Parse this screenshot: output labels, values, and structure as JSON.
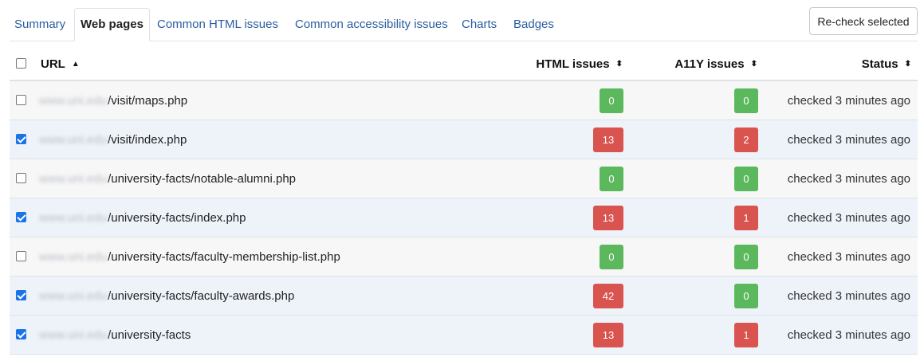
{
  "tabs": [
    {
      "label": "Summary"
    },
    {
      "label": "Web pages",
      "active": true
    },
    {
      "label": "Common HTML issues"
    },
    {
      "label": "Common accessibility issues"
    },
    {
      "label": "Charts"
    },
    {
      "label": "Badges"
    }
  ],
  "recheck_button": "Re-check selected",
  "columns": {
    "url": "URL",
    "html": "HTML issues",
    "a11y": "A11Y issues",
    "status": "Status"
  },
  "sort_icons": {
    "asc": "▲",
    "both": "⬍"
  },
  "colors": {
    "ok": "#5cb85c",
    "bad": "#d9534f",
    "link": "#2a5d9f"
  },
  "host_redacted": "www.uni.edu",
  "rows": [
    {
      "path": "/visit/maps.php",
      "selected": false,
      "html": "0",
      "html_state": "ok",
      "a11y": "0",
      "a11y_state": "ok",
      "status": "checked 3 minutes ago"
    },
    {
      "path": "/visit/index.php",
      "selected": true,
      "html": "13",
      "html_state": "bad",
      "a11y": "2",
      "a11y_state": "bad",
      "status": "checked 3 minutes ago"
    },
    {
      "path": "/university-facts/notable-alumni.php",
      "selected": false,
      "html": "0",
      "html_state": "ok",
      "a11y": "0",
      "a11y_state": "ok",
      "status": "checked 3 minutes ago"
    },
    {
      "path": "/university-facts/index.php",
      "selected": true,
      "html": "13",
      "html_state": "bad",
      "a11y": "1",
      "a11y_state": "bad",
      "status": "checked 3 minutes ago"
    },
    {
      "path": "/university-facts/faculty-membership-list.php",
      "selected": false,
      "html": "0",
      "html_state": "ok",
      "a11y": "0",
      "a11y_state": "ok",
      "status": "checked 3 minutes ago"
    },
    {
      "path": "/university-facts/faculty-awards.php",
      "selected": true,
      "html": "42",
      "html_state": "bad",
      "a11y": "0",
      "a11y_state": "ok",
      "status": "checked 3 minutes ago"
    },
    {
      "path": "/university-facts",
      "selected": true,
      "html": "13",
      "html_state": "bad",
      "a11y": "1",
      "a11y_state": "bad",
      "status": "checked 3 minutes ago"
    }
  ]
}
